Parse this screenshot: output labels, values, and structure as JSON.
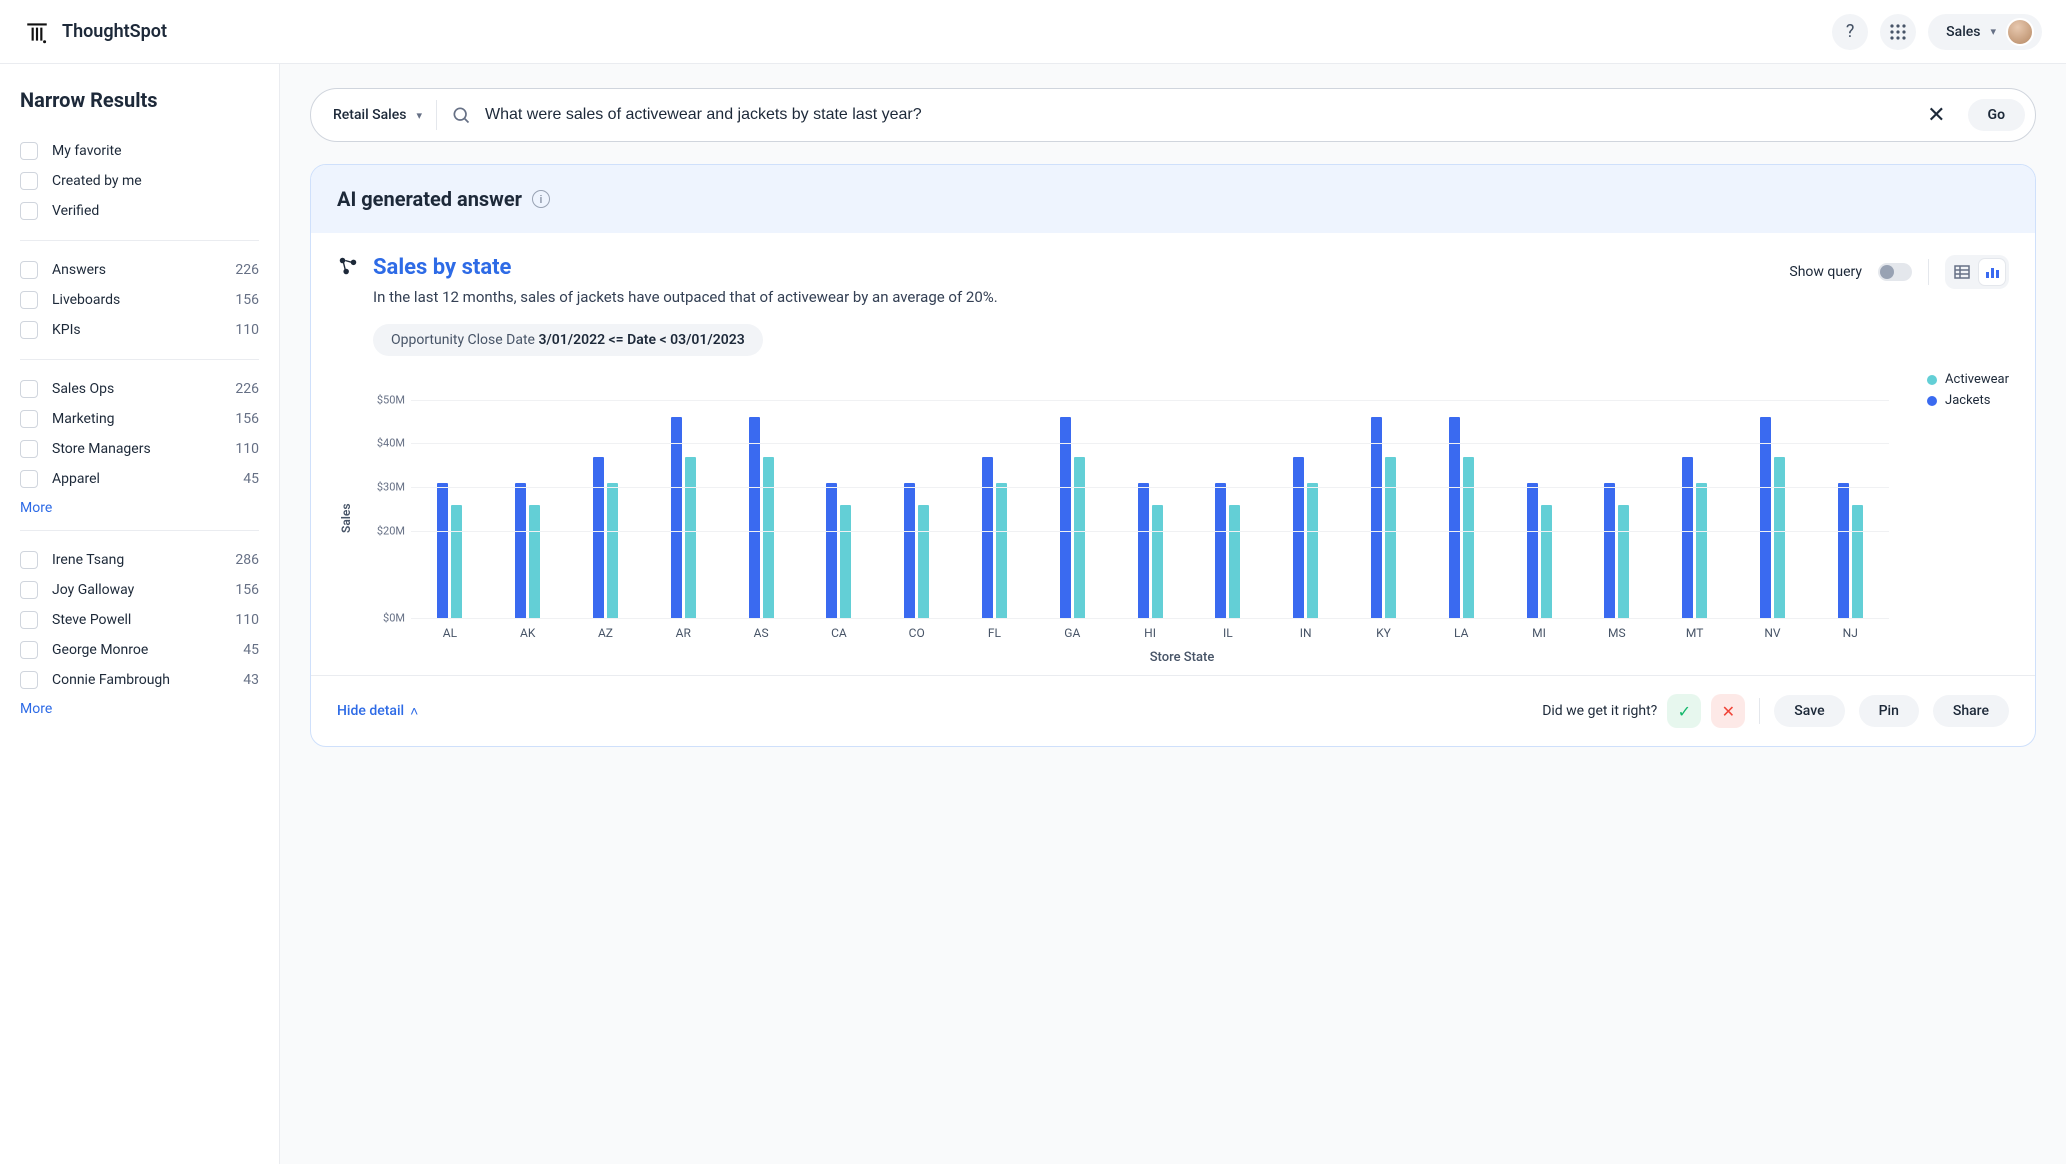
{
  "brand": "ThoughtSpot",
  "topnav": {
    "sales_label": "Sales"
  },
  "sidebar": {
    "title": "Narrow Results",
    "more": "More",
    "group1": [
      {
        "label": "My favorite"
      },
      {
        "label": "Created by me"
      },
      {
        "label": "Verified"
      }
    ],
    "group2": [
      {
        "label": "Answers",
        "count": "226"
      },
      {
        "label": "Liveboards",
        "count": "156"
      },
      {
        "label": "KPIs",
        "count": "110"
      }
    ],
    "group3": [
      {
        "label": "Sales Ops",
        "count": "226"
      },
      {
        "label": "Marketing",
        "count": "156"
      },
      {
        "label": "Store Managers",
        "count": "110"
      },
      {
        "label": "Apparel",
        "count": "45"
      }
    ],
    "group4": [
      {
        "label": "Irene Tsang",
        "count": "286"
      },
      {
        "label": "Joy Galloway",
        "count": "156"
      },
      {
        "label": "Steve Powell",
        "count": "110"
      },
      {
        "label": "George Monroe",
        "count": "45"
      },
      {
        "label": "Connie Fambrough",
        "count": "43"
      }
    ]
  },
  "search": {
    "datasource": "Retail Sales",
    "query": "What were sales of activewear and jackets by state last year?",
    "go": "Go"
  },
  "answer": {
    "header": "AI generated answer",
    "title": "Sales by state",
    "description": "In the last 12 months, sales of jackets have outpaced that of activewear by an average of 20%.",
    "filter_prefix": "Opportunity Close Date ",
    "filter_range": "3/01/2022 <= Date < 03/01/2023",
    "show_query": "Show query",
    "hide_detail": "Hide detail",
    "feedback_prompt": "Did we get it right?",
    "actions": {
      "save": "Save",
      "pin": "Pin",
      "share": "Share"
    }
  },
  "chart_data": {
    "type": "bar",
    "title": "Sales by state",
    "xlabel": "Store State",
    "ylabel": "Sales",
    "ylim": [
      0,
      55
    ],
    "yticks": [
      "$0M",
      "$20M",
      "$30M",
      "$40M",
      "$50M"
    ],
    "ytick_vals": [
      0,
      20,
      30,
      40,
      50
    ],
    "categories": [
      "AL",
      "AK",
      "AZ",
      "AR",
      "AS",
      "CA",
      "CO",
      "FL",
      "GA",
      "HI",
      "IL",
      "IN",
      "KY",
      "LA",
      "MI",
      "MS",
      "MT",
      "NV",
      "NJ"
    ],
    "series": [
      {
        "name": "Jackets",
        "color": "#3a6af0",
        "values": [
          31,
          31,
          37,
          46,
          46,
          31,
          31,
          37,
          46,
          31,
          31,
          37,
          46,
          46,
          31,
          31,
          37,
          46,
          31
        ]
      },
      {
        "name": "Activewear",
        "color": "#63cfd6",
        "values": [
          26,
          26,
          31,
          37,
          37,
          26,
          26,
          31,
          37,
          26,
          26,
          31,
          37,
          37,
          26,
          26,
          31,
          37,
          26
        ]
      }
    ],
    "legend": [
      "Activewear",
      "Jackets"
    ]
  }
}
